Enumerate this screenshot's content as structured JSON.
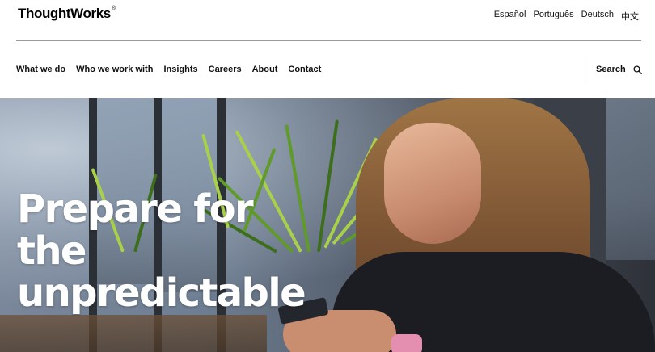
{
  "header": {
    "logo_text": "ThoughtWorks",
    "logo_mark": "®",
    "languages": [
      {
        "label": "Español"
      },
      {
        "label": "Português"
      },
      {
        "label": "Deutsch"
      },
      {
        "label": "中文"
      }
    ]
  },
  "nav": {
    "items": [
      {
        "label": "What we do"
      },
      {
        "label": "Who we work with"
      },
      {
        "label": "Insights"
      },
      {
        "label": "Careers"
      },
      {
        "label": "About"
      },
      {
        "label": "Contact"
      }
    ],
    "search_label": "Search",
    "search_icon": "search-icon"
  },
  "hero": {
    "headline_line1": "Prepare for the",
    "headline_line2": "unpredictable"
  },
  "colors": {
    "text": "#111111",
    "hero_text": "#ffffff",
    "divider": "#9a9a9a"
  }
}
